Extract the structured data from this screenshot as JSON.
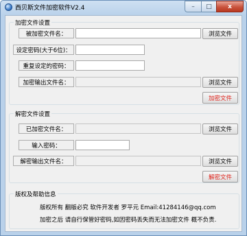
{
  "window": {
    "title": "西贝斯文件加密软件V2.4",
    "icon": "app-globe-icon",
    "controls": {
      "minimize": "–",
      "maximize": "□",
      "close": "x"
    }
  },
  "encrypt": {
    "legend": "加密文件设置",
    "file_label": "被加密文件名：",
    "file_value": "",
    "browse_label": "浏览文件",
    "password_label": "设定密码(大于6位)：",
    "password_value": "",
    "confirm_label": "重复设定的密码：",
    "confirm_value": "",
    "output_label": "加密输出文件名：",
    "output_value": "",
    "output_browse_label": "浏览文件",
    "action_label": "加密文件"
  },
  "decrypt": {
    "legend": "解密文件设置",
    "file_label": "已加密文件名：",
    "file_value": "",
    "browse_label": "浏览文件",
    "password_label": "输入密码：",
    "password_value": "",
    "output_label": "解密输出文件名：",
    "output_value": "",
    "output_browse_label": "浏览文件",
    "action_label": "解密文件"
  },
  "info": {
    "legend": "版权及帮助信息",
    "line1": "版权所有 翻版必究 软件开发者 罗平元 Email:41284146@qq.com",
    "line2": "加密之后 请自行保管好密码,如因密码丢失而无法加密文件 概不负责."
  },
  "colors": {
    "action_text": "#e0241c",
    "title_gradient": "#b9d1ea"
  }
}
